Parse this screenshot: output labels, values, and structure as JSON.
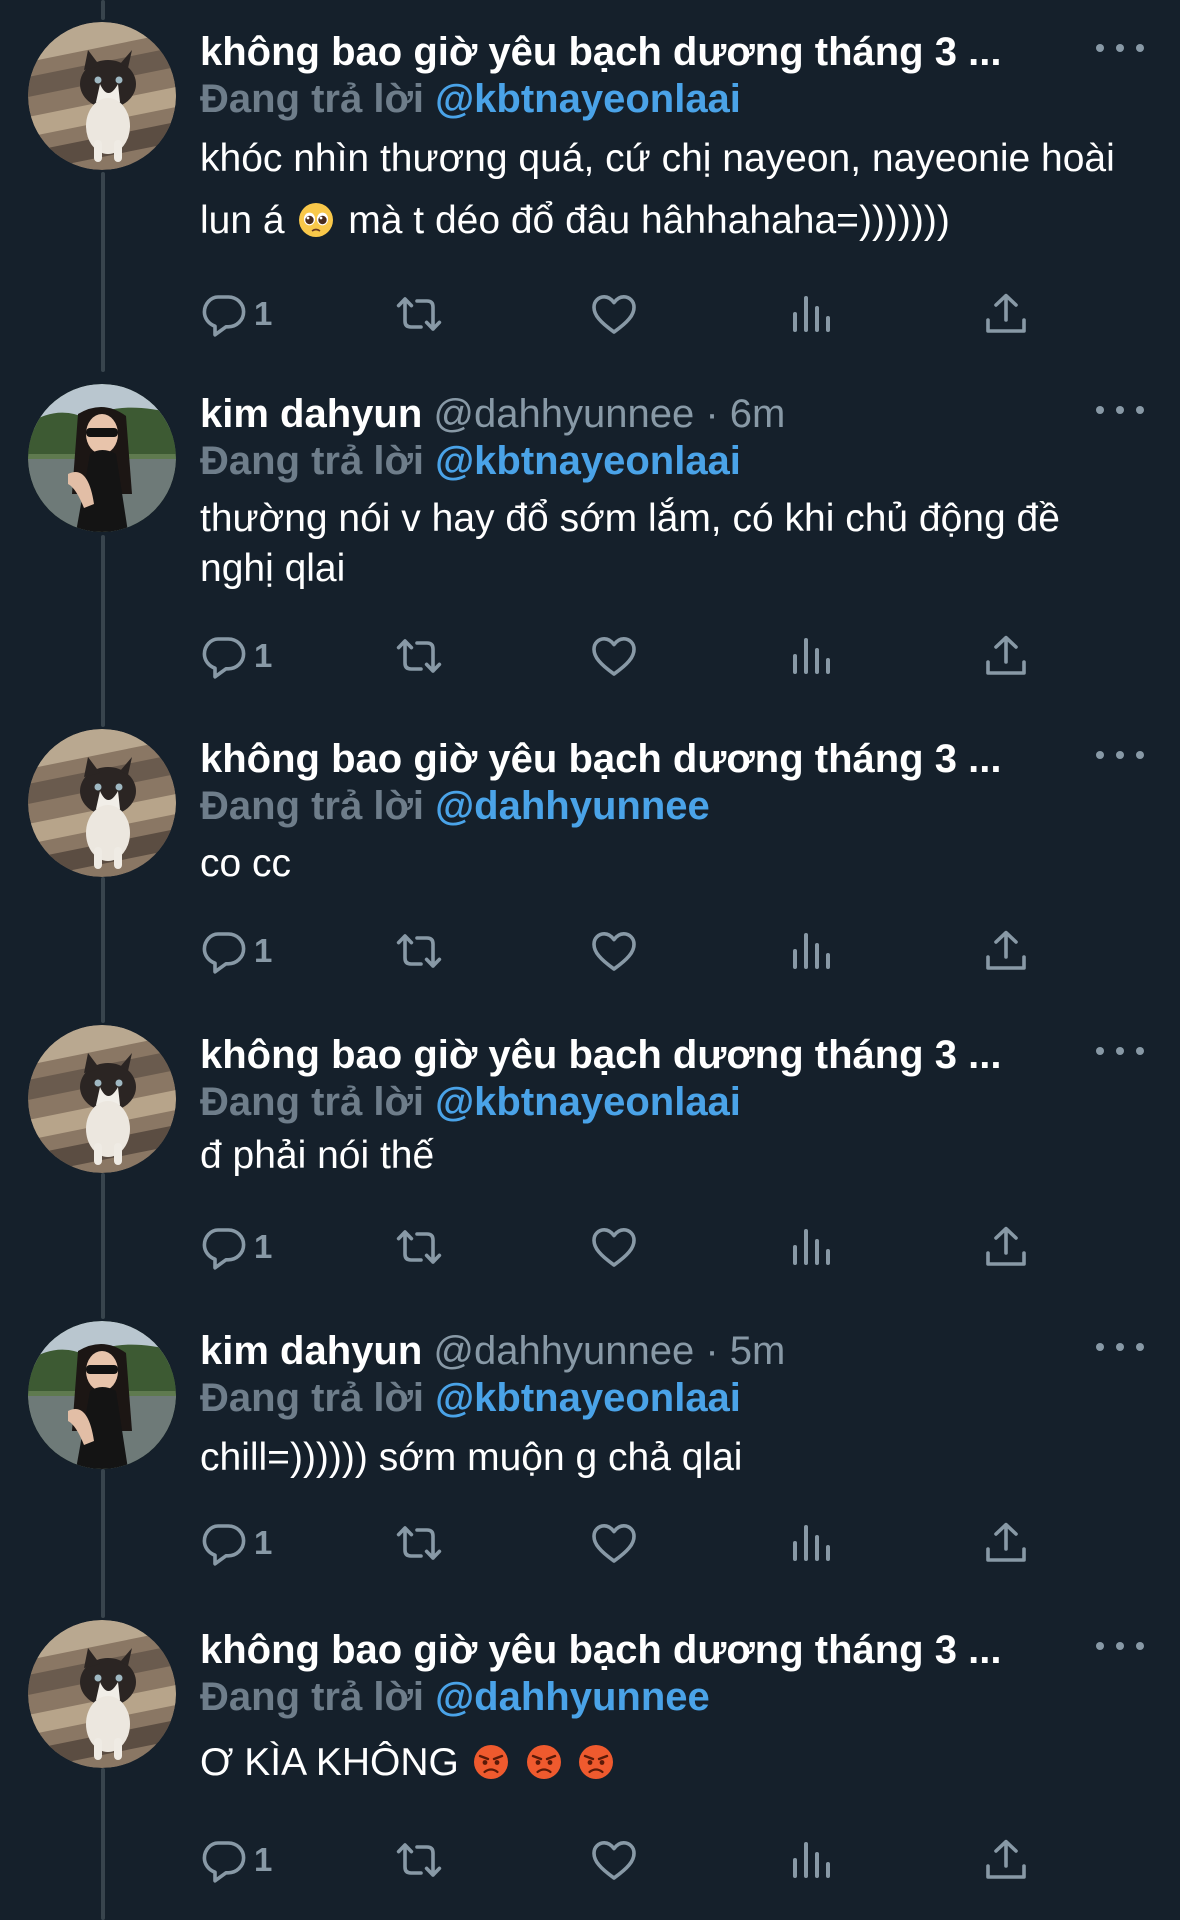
{
  "colors": {
    "background": "#15202b",
    "secondary_text": "#8899a6",
    "mention": "#4aa3e8",
    "thread_line": "#38444d"
  },
  "tweets": [
    {
      "name": "không bao giờ yêu bạch dương tháng 3 ...",
      "handle": "",
      "time": "",
      "replying_label": "Đang trả lời",
      "replying_to": "@kbtnayeonlaai",
      "text_a": "khóc nhìn thương quá, cứ chị nayeon, nayeonie hoài lun á",
      "text_b": "mà t déo đổ đâu hâhhahaha=)))))))",
      "reply_count": "1",
      "avatar": "cat-avatar",
      "emoji": "pleading-face"
    },
    {
      "name": "kim dahyun",
      "handle": "@dahhyunnee",
      "dot": "·",
      "time": "6m",
      "replying_label": "Đang trả lời",
      "replying_to": "@kbtnayeonlaai",
      "text": "thường nói v hay đổ sớm lắm, có khi chủ động đề nghị qlai",
      "reply_count": "1",
      "avatar": "girl-avatar"
    },
    {
      "name": "không bao giờ yêu bạch dương tháng 3 ...",
      "replying_label": "Đang trả lời",
      "replying_to": "@dahhyunnee",
      "text": "co cc",
      "reply_count": "1",
      "avatar": "cat-avatar"
    },
    {
      "name": "không bao giờ yêu bạch dương tháng 3 ...",
      "replying_label": "Đang trả lời",
      "replying_to": "@kbtnayeonlaai",
      "text": "đ phải nói thế",
      "reply_count": "1",
      "avatar": "cat-avatar"
    },
    {
      "name": "kim dahyun",
      "handle": "@dahhyunnee",
      "dot": "·",
      "time": "5m",
      "replying_label": "Đang trả lời",
      "replying_to": "@kbtnayeonlaai",
      "text": "chill=)))))) sớm muộn g chả qlai",
      "reply_count": "1",
      "avatar": "girl-avatar"
    },
    {
      "name": "không bao giờ yêu bạch dương tháng 3 ...",
      "replying_label": "Đang trả lời",
      "replying_to": "@dahhyunnee",
      "text": "Ơ KÌA KHÔNG",
      "reply_count": "1",
      "avatar": "cat-avatar",
      "emoji": "pouting-face x3"
    }
  ]
}
